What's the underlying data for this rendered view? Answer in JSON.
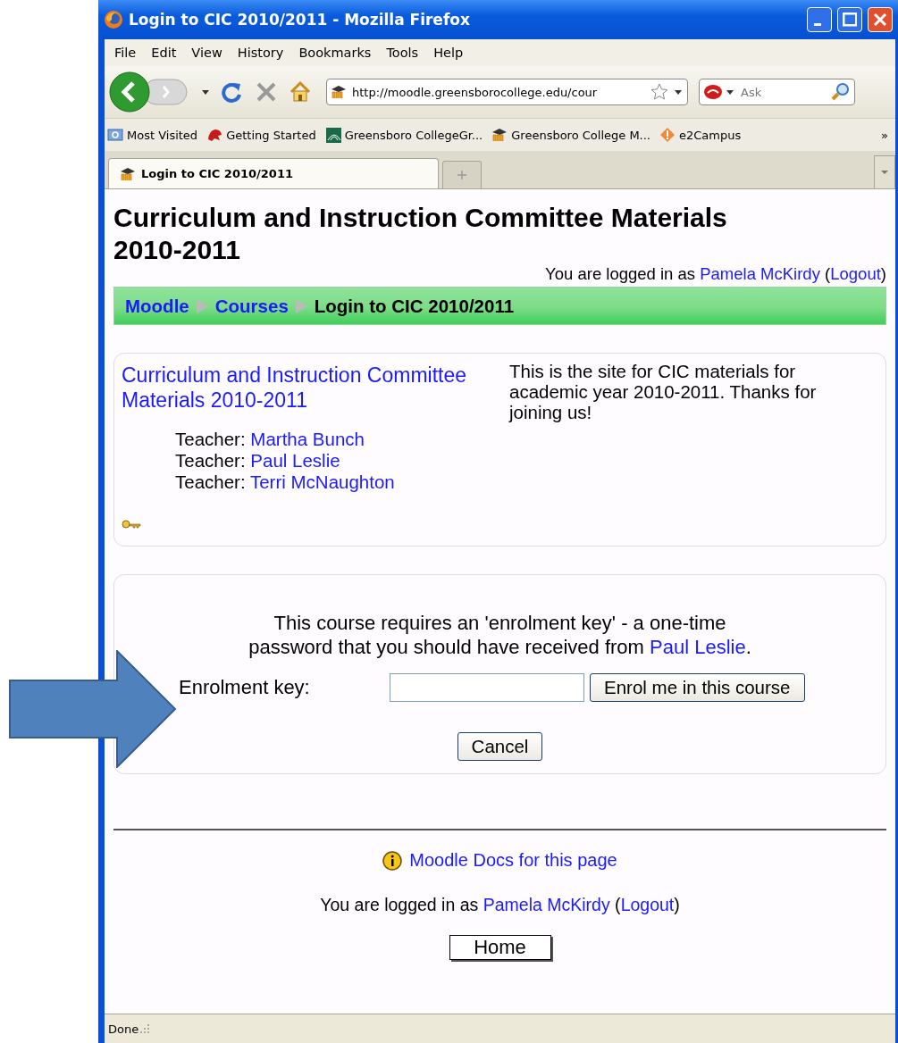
{
  "window": {
    "title": "Login to CIC 2010/2011 - Mozilla Firefox"
  },
  "menu": [
    "File",
    "Edit",
    "View",
    "History",
    "Bookmarks",
    "Tools",
    "Help"
  ],
  "address": {
    "value": "http://moodle.greensborocollege.edu/cour"
  },
  "search": {
    "placeholder": "Ask"
  },
  "bookmarks": [
    "Most Visited",
    "Getting Started",
    "Greensboro CollegeGr...",
    "Greensboro College M...",
    "e2Campus"
  ],
  "bookmarks_more": "»",
  "tabs": [
    {
      "label": "Login to CIC 2010/2011",
      "selected": true
    }
  ],
  "page": {
    "heading": "Curriculum and Instruction Committee Materials 2010-2011",
    "login_info": {
      "prefix": "You are logged in as",
      "user": "Pamela McKirdy",
      "open": "(",
      "logout": "Logout",
      "close": ")"
    },
    "breadcrumb": [
      {
        "label": "Moodle",
        "link": true
      },
      {
        "label": "Courses",
        "link": true
      },
      {
        "label": "Login to CIC 2010/2011",
        "link": false
      }
    ],
    "course": {
      "title": "Curriculum and Instruction Committee Materials 2010-2011",
      "teachers": [
        {
          "role": "Teacher:",
          "name": "Martha Bunch"
        },
        {
          "role": "Teacher:",
          "name": "Paul Leslie"
        },
        {
          "role": "Teacher:",
          "name": "Terri McNaughton"
        }
      ],
      "summary": "This is the site for CIC materials for academic year 2010-2011.  Thanks for joining us!"
    },
    "enrol": {
      "message": "This course requires an 'enrolment key' - a one-time password that you should have received from",
      "teacher": "Paul Leslie",
      "message_end": ".",
      "label": "Enrolment key:",
      "submit": "Enrol me in this course",
      "cancel": "Cancel"
    },
    "footer": {
      "docs": "Moodle Docs for this page",
      "login_info": {
        "prefix": "You are logged in as",
        "user": "Pamela McKirdy",
        "open": "(",
        "logout": "Logout",
        "close": ")"
      },
      "home": "Home"
    }
  },
  "status_bar": "Done"
}
